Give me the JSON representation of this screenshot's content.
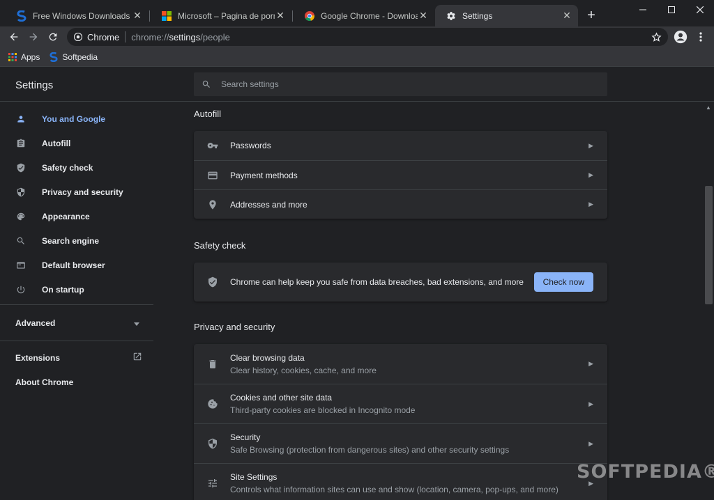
{
  "tabs": [
    {
      "label": "Free Windows Downloads",
      "icon": "softpedia-s-icon"
    },
    {
      "label": "Microsoft – Pagina de pornire of",
      "icon": "microsoft-logo-icon"
    },
    {
      "label": "Google Chrome - Download the",
      "icon": "chrome-icon"
    },
    {
      "label": "Settings",
      "icon": "gear-icon"
    }
  ],
  "omnibox": {
    "chip": "Chrome",
    "url_prefix": "chrome://",
    "url_host": "settings",
    "url_path": "/people"
  },
  "bookmarks": [
    {
      "label": "Apps"
    },
    {
      "label": "Softpedia"
    }
  ],
  "header": {
    "title": "Settings",
    "search_placeholder": "Search settings"
  },
  "sidebar": {
    "items": [
      {
        "label": "You and Google",
        "icon": "person-icon"
      },
      {
        "label": "Autofill",
        "icon": "clipboard-icon"
      },
      {
        "label": "Safety check",
        "icon": "shield-check-icon"
      },
      {
        "label": "Privacy and security",
        "icon": "shield-icon"
      },
      {
        "label": "Appearance",
        "icon": "palette-icon"
      },
      {
        "label": "Search engine",
        "icon": "search-icon"
      },
      {
        "label": "Default browser",
        "icon": "browser-icon"
      },
      {
        "label": "On startup",
        "icon": "power-icon"
      }
    ],
    "advanced": "Advanced",
    "extensions": "Extensions",
    "about": "About Chrome"
  },
  "autofill": {
    "title": "Autofill",
    "rows": [
      {
        "label": "Passwords",
        "icon": "key-icon"
      },
      {
        "label": "Payment methods",
        "icon": "credit-card-icon"
      },
      {
        "label": "Addresses and more",
        "icon": "location-pin-icon"
      }
    ]
  },
  "safety": {
    "title": "Safety check",
    "text": "Chrome can help keep you safe from data breaches, bad extensions, and more",
    "button": "Check now"
  },
  "privacy": {
    "title": "Privacy and security",
    "rows": [
      {
        "label": "Clear browsing data",
        "sub": "Clear history, cookies, cache, and more",
        "icon": "trash-icon"
      },
      {
        "label": "Cookies and other site data",
        "sub": "Third-party cookies are blocked in Incognito mode",
        "icon": "cookie-icon"
      },
      {
        "label": "Security",
        "sub": "Safe Browsing (protection from dangerous sites) and other security settings",
        "icon": "shield-icon"
      },
      {
        "label": "Site Settings",
        "sub": "Controls what information sites can use and show (location, camera, pop-ups, and more)",
        "icon": "sliders-icon"
      }
    ]
  },
  "watermark": "SOFTPEDIA®",
  "colors": {
    "accent": "#8ab4f8",
    "background": "#202124",
    "card": "#292a2d"
  }
}
